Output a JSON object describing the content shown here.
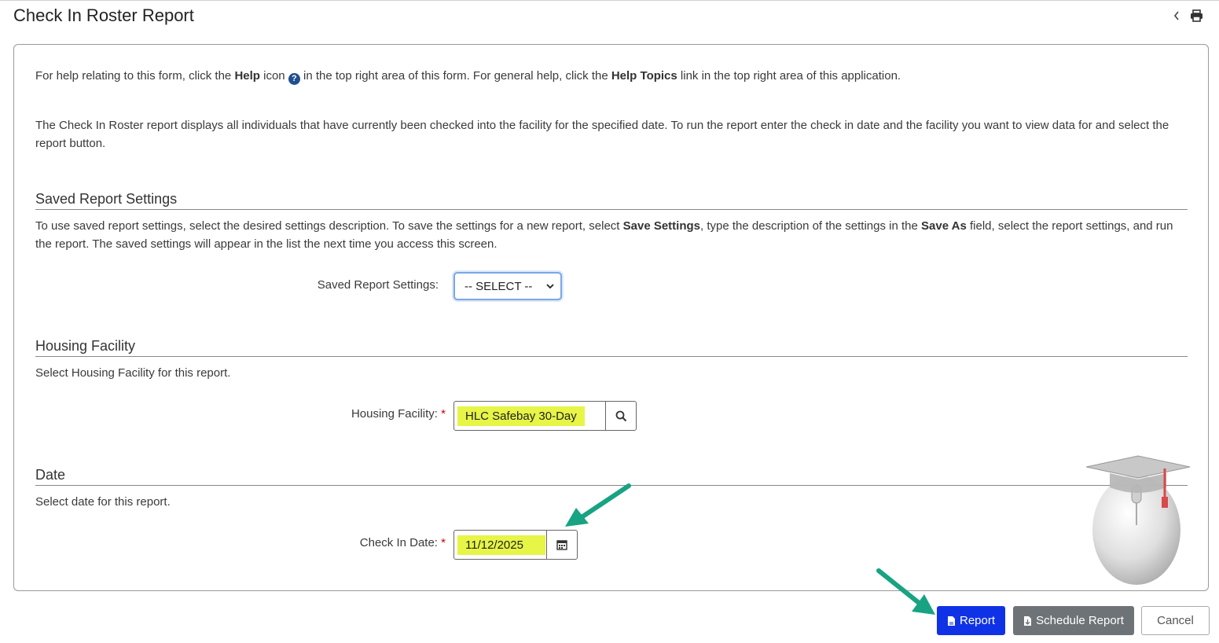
{
  "page": {
    "title": "Check In Roster Report"
  },
  "header": {
    "collapse_icon": "chevron-left-icon",
    "print_icon": "print-icon"
  },
  "help": {
    "part1": "For help relating to this form, click the ",
    "help_word": "Help",
    "part2": " icon ",
    "part3": " in the top right area of this form.  For general help, click the ",
    "help_topics": "Help Topics",
    "part4": " link in the top right area of this application."
  },
  "description": "The Check In Roster report displays all individuals that have currently been checked into the facility for the specified date. To run the report enter the check in date and the facility you want to view data for and select the report button.",
  "saved_settings": {
    "section_title": "Saved Report Settings",
    "desc_part1": "To use saved report settings, select the desired settings description. To save the settings for a new report, select ",
    "save_settings": "Save Settings",
    "desc_part2": ", type the description of the settings in the ",
    "save_as": "Save As",
    "desc_part3": " field, select the report settings, and run the report. The saved settings will appear in the list the next time you access this screen.",
    "label": "Saved Report Settings:",
    "select_value": "-- SELECT --"
  },
  "housing": {
    "section_title": "Housing Facility",
    "desc": "Select Housing Facility for this report.",
    "label": "Housing Facility:",
    "required": "*",
    "value": "HLC Safebay 30-Day",
    "button_icon": "search-icon"
  },
  "date": {
    "section_title": "Date",
    "desc": "Select date for this report.",
    "label": "Check In Date:",
    "required": "*",
    "value": "11/12/2025",
    "button_icon": "calendar-icon"
  },
  "footer": {
    "report_label": "Report",
    "schedule_label": "Schedule Report",
    "cancel_label": "Cancel"
  },
  "colors": {
    "highlight": "#e6f546",
    "primary_button": "#1032e6",
    "secondary_button": "#6e7378",
    "arrow": "#18a383"
  }
}
